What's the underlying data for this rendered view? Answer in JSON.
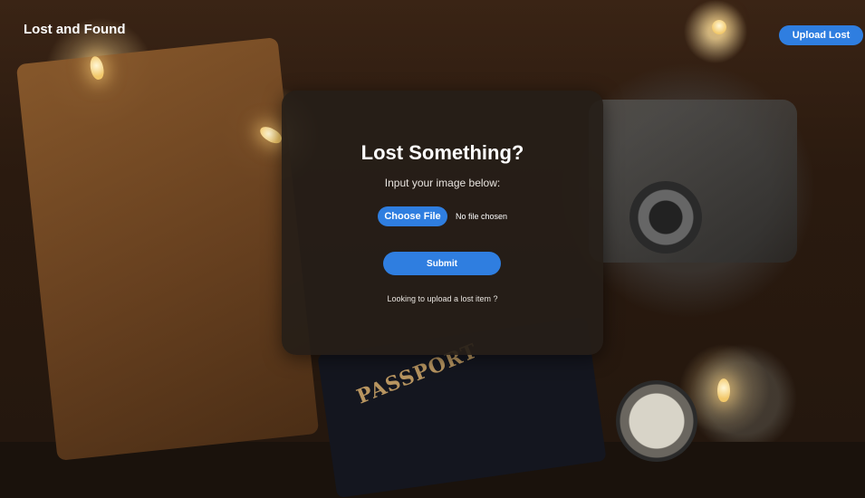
{
  "header": {
    "app_title": "Lost and Found",
    "upload_lost_label": "Upload Lost"
  },
  "card": {
    "title": "Lost Something?",
    "subtitle": "Input your image below:",
    "choose_file_label": "Choose File",
    "file_status": "No file chosen",
    "submit_label": "Submit",
    "upload_link_text": "Looking to upload a lost item ?"
  },
  "colors": {
    "accent": "#2f7ee0",
    "card_background": "#261e18",
    "text": "#ffffff"
  },
  "background": {
    "passport_text": "PASSPORT"
  }
}
